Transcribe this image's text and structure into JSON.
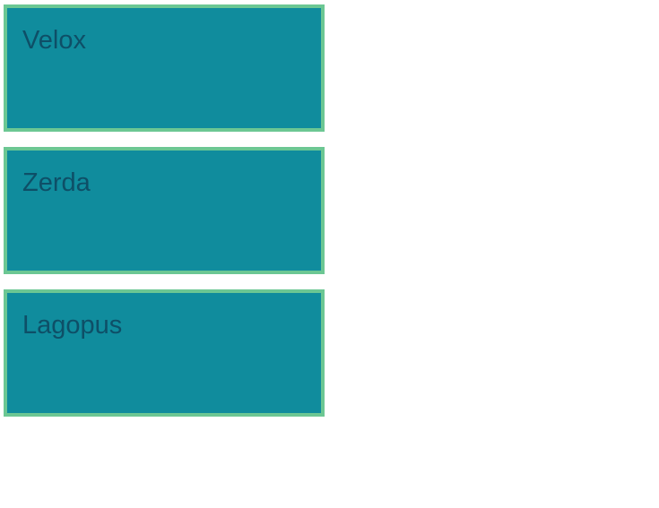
{
  "cards": [
    {
      "label": "Velox"
    },
    {
      "label": "Zerda"
    },
    {
      "label": "Lagopus"
    }
  ],
  "colors": {
    "page_background": "#ffffff",
    "card_fill": "#108c9d",
    "card_border": "#6cc793",
    "card_text": "#0e4f67"
  }
}
